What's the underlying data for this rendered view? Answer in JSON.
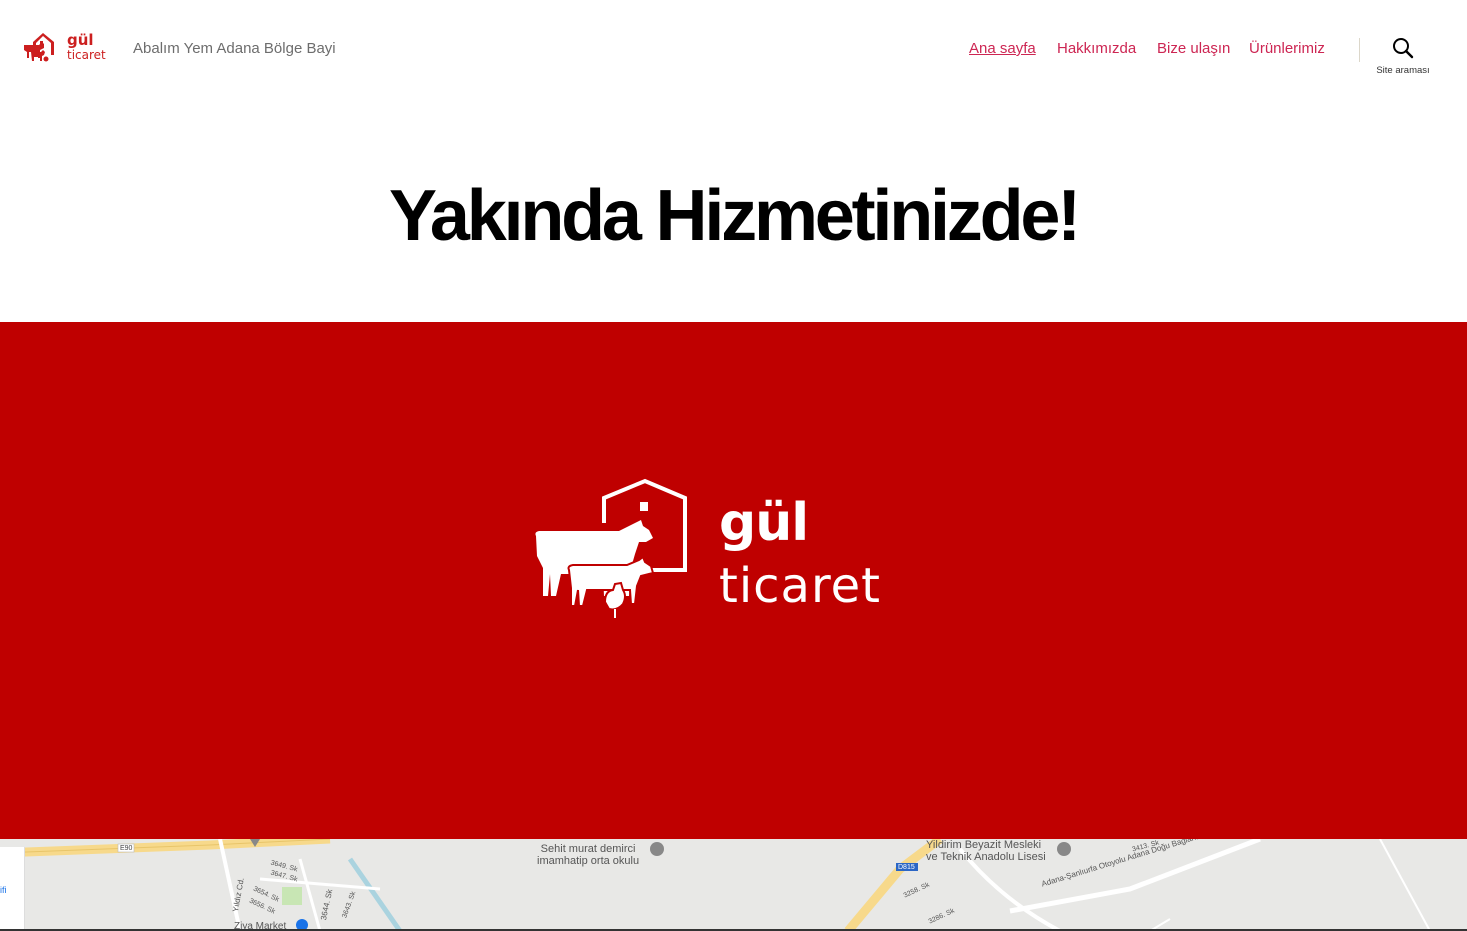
{
  "site": {
    "logo_alt": "gül ticaret",
    "tagline": "Abalım Yem Adana Bölge Bayi"
  },
  "nav": {
    "items": [
      {
        "label": "Ana sayfa",
        "current": true
      },
      {
        "label": "Hakkımızda",
        "current": false
      },
      {
        "label": "Bize ulaşın",
        "current": false
      },
      {
        "label": "Ürünlerimiz",
        "current": false
      }
    ],
    "search_label": "Site araması",
    "search_icon": "search-icon"
  },
  "page": {
    "title": "Yakında Hizmetinizde!"
  },
  "hero": {
    "brand_line1": "gül",
    "brand_line2": "ticaret"
  },
  "map": {
    "labels": [
      "Sehit murat demirci\nimamhatip orta okulu",
      "Yildirim Beyazit Mesleki\nve Teknik Anadolu Lisesi",
      "Ziya Market",
      "E90",
      "D815",
      "Adana-Şanlıurfa Otoyolu Adana Doğu Bağlantısı",
      "Yıldız Cd.",
      "3644. Sk",
      "3649. Sk",
      "3647. Sk",
      "3654. Sk",
      "3656. Sk",
      "3643. Sk",
      "3258. Sk",
      "3286. Sk",
      "3413. Sk",
      "ifi"
    ]
  },
  "colors": {
    "accent": "#cd2653",
    "hero_bg": "#bf0000",
    "logo_red": "#cc1f1f",
    "title": "#000000",
    "tagline": "#6d6d6d"
  }
}
